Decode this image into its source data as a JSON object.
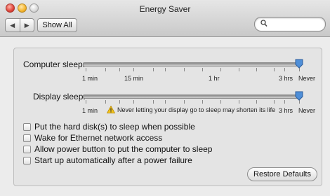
{
  "window": {
    "title": "Energy Saver"
  },
  "toolbar": {
    "back_icon": "back-arrow-icon",
    "forward_icon": "forward-arrow-icon",
    "show_all_label": "Show All",
    "search": {
      "value": "",
      "placeholder": ""
    }
  },
  "computer_sleep": {
    "label": "Computer sleep:",
    "tick_labels": [
      "1 min",
      "15 min",
      "1 hr",
      "3 hrs",
      "Never"
    ],
    "selected": "Never"
  },
  "display_sleep": {
    "label": "Display sleep:",
    "tick_labels": [
      "1 min",
      "3 hrs",
      "Never"
    ],
    "warning": "Never letting your display go to sleep may shorten its life",
    "selected": "Never"
  },
  "options": [
    {
      "label": "Put the hard disk(s) to sleep when possible",
      "checked": false
    },
    {
      "label": "Wake for Ethernet network access",
      "checked": false
    },
    {
      "label": "Allow power button to put the computer to sleep",
      "checked": false
    },
    {
      "label": "Start up automatically after a power failure",
      "checked": false
    }
  ],
  "restore_label": "Restore Defaults",
  "colors": {
    "knob": "#4f8fd8",
    "warning": "#f2c21b"
  }
}
